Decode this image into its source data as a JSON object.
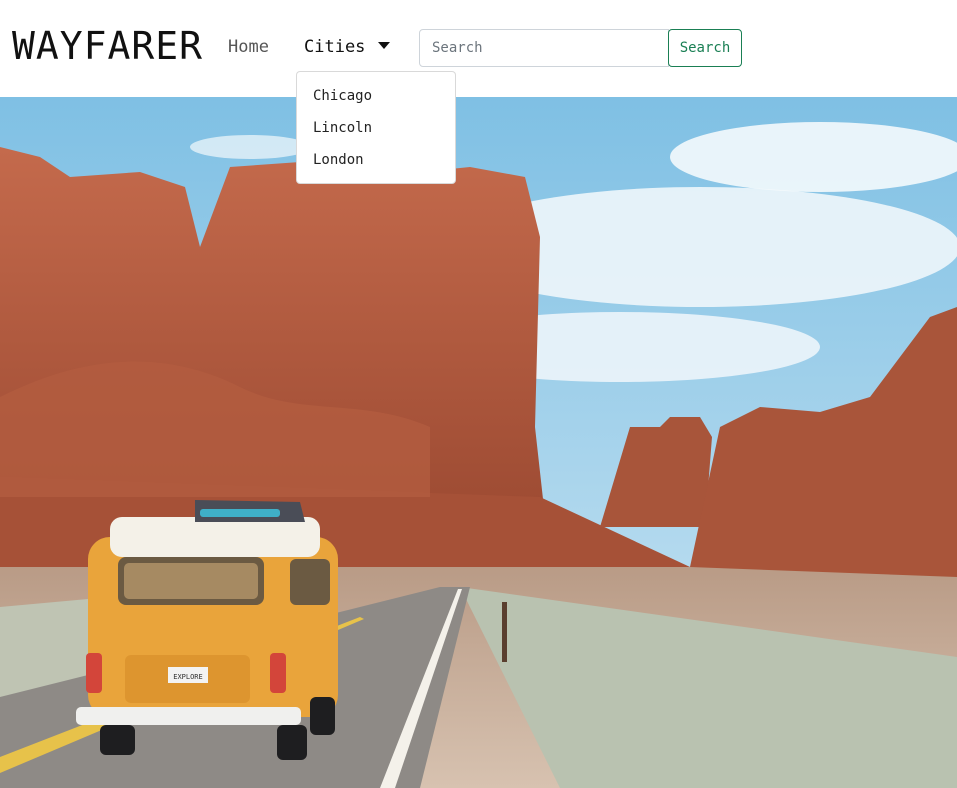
{
  "brand": {
    "name": "WAYFARER"
  },
  "nav": {
    "home_label": "Home",
    "cities_label": "Cities",
    "cities_menu": [
      "Chicago",
      "Lincoln",
      "London"
    ]
  },
  "search": {
    "placeholder": "Search",
    "value": "",
    "button_label": "Search"
  },
  "hero": {
    "plate_text": "EXPLORE",
    "description_icon": "desert-road-van-photo"
  },
  "colors": {
    "accent": "#1a7f54",
    "sky": "#8fc9e6",
    "rock": "#b65c40",
    "van": "#e9a43b"
  }
}
